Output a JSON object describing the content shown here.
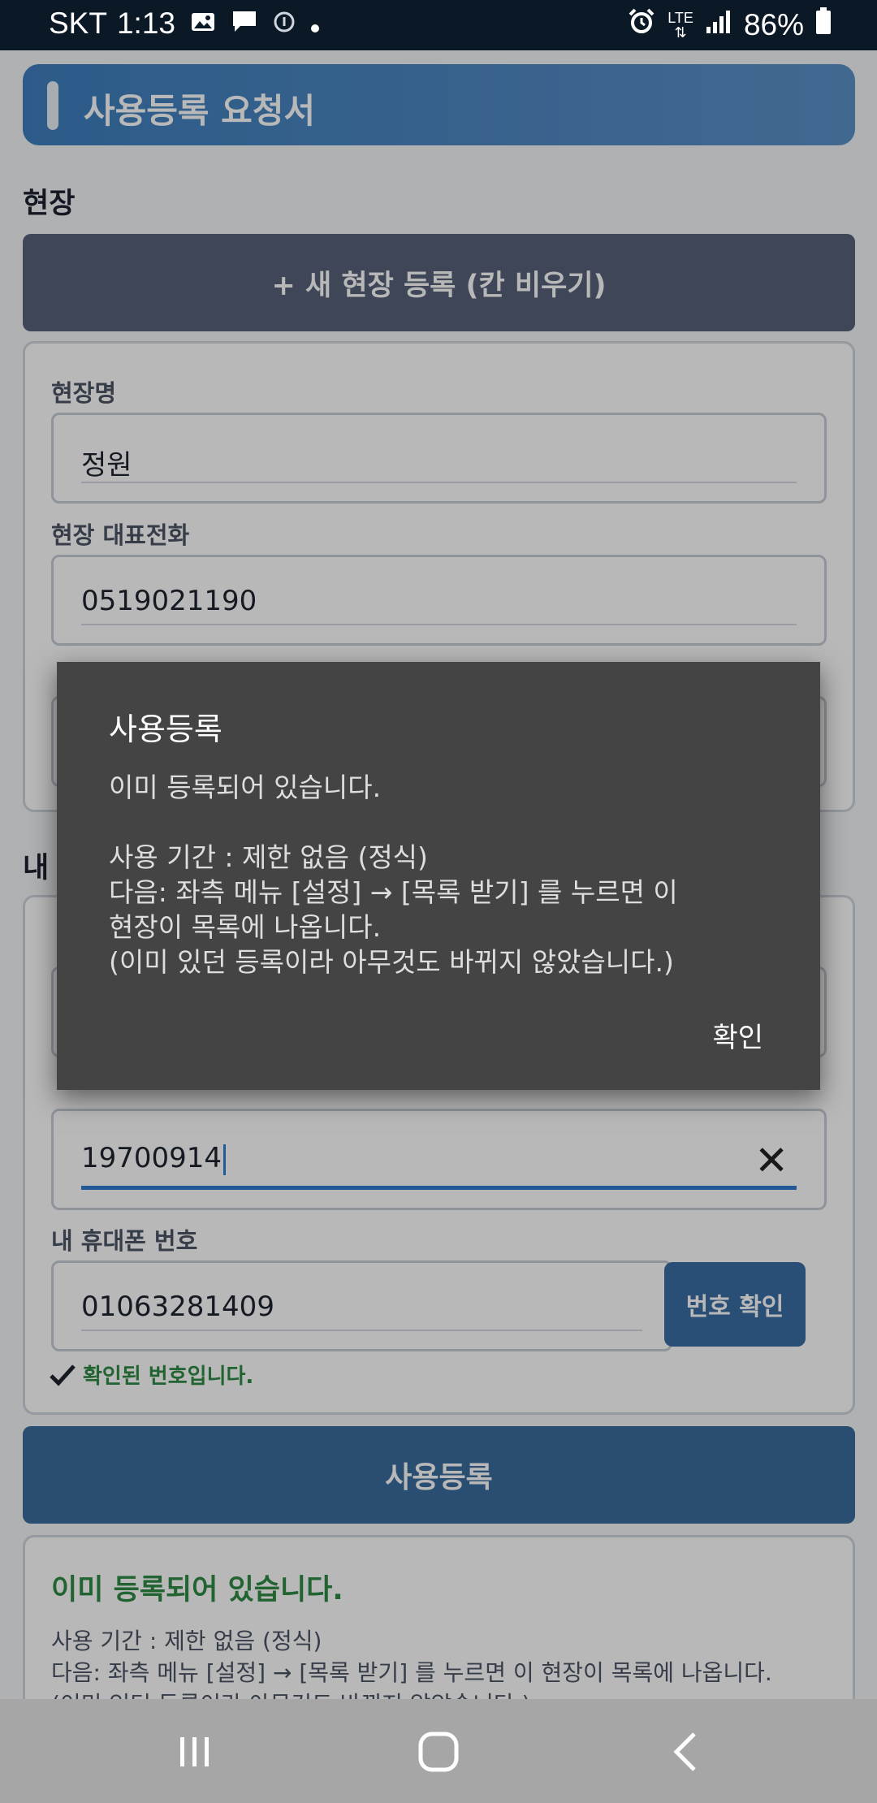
{
  "status_bar": {
    "carrier": "SKT",
    "time": "1:13",
    "network": "LTE",
    "battery": "86%"
  },
  "header": {
    "title": "사용등록 요청서"
  },
  "site_section": {
    "label": "현장",
    "new_site_button": "+ 새 현장 등록 (칸 비우기)",
    "fields": {
      "site_name_label": "현장명",
      "site_name_value": "정원",
      "site_phone_label": "현장 대표전화",
      "site_phone_value": "0519021190"
    }
  },
  "my_section": {
    "label": "내",
    "birth_value": "19700914",
    "phone_label": "내 휴대폰 번호",
    "phone_value": "01063281409",
    "verify_button": "번호 확인",
    "verified_text": "확인된 번호입니다."
  },
  "submit_button": "사용등록",
  "result": {
    "title": "이미 등록되어 있습니다.",
    "lines": [
      "사용 기간 : 제한 없음 (정식)",
      "다음: 좌측 메뉴 [설정] → [목록 받기] 를 누르면 이 현장이 목록에 나옵니다.",
      "(이미 있던 등록이라 아무것도 바뀌지 않았습니다.)"
    ]
  },
  "dialog": {
    "title": "사용등록",
    "message_lines": [
      "이미 등록되어 있습니다.",
      "",
      "사용 기간 : 제한 없음 (정식)",
      "다음: 좌측 메뉴 [설정] → [목록 받기] 를 누르면 이",
      "현장이 목록에 나옵니다.",
      "(이미 있던 등록이라 아무것도 바뀌지 않았습니다.)"
    ],
    "ok_button": "확인"
  },
  "colors": {
    "title_bar": "#4f89c4",
    "dark_button": "#56627a",
    "submit_button": "#3a6d9f",
    "success_green": "#2e8a45",
    "dialog_bg": "#444444"
  }
}
